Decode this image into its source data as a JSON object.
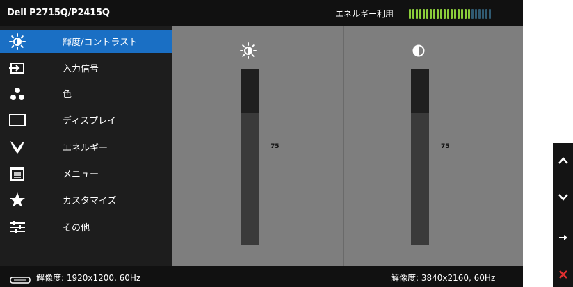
{
  "header": {
    "model": "Dell P2715Q/P2415Q",
    "energy_label": "エネルギー利用",
    "energy_level": 0.75,
    "energy_colors": {
      "on": "#8bcd3a",
      "off": "#305a72"
    }
  },
  "sidebar": {
    "items": [
      {
        "label": "輝度/コントラスト",
        "icon": "brightness-sun-icon",
        "active": true
      },
      {
        "label": "入力信号",
        "icon": "input-source-icon",
        "active": false
      },
      {
        "label": "色",
        "icon": "color-dots-icon",
        "active": false
      },
      {
        "label": "ディスプレイ",
        "icon": "display-rectangle-icon",
        "active": false
      },
      {
        "label": "エネルギー",
        "icon": "energy-leaf-icon",
        "active": false
      },
      {
        "label": "メニュー",
        "icon": "menu-list-icon",
        "active": false
      },
      {
        "label": "カスタマイズ",
        "icon": "star-icon",
        "active": false
      },
      {
        "label": "その他",
        "icon": "other-settings-icon",
        "active": false
      }
    ],
    "accent_color": "#1a6fc4"
  },
  "main": {
    "brightness": {
      "icon": "brightness-sun-icon",
      "value": "75",
      "level": 0.75
    },
    "contrast": {
      "icon": "contrast-half-circle-icon",
      "value": "75",
      "level": 0.75
    }
  },
  "status": {
    "input_icon": "cable-connector-icon",
    "current_resolution": "解像度: 1920x1200, 60Hz",
    "optimal_resolution": "解像度: 3840x2160, 60Hz"
  },
  "controls": {
    "buttons": [
      {
        "icon": "chevron-up-icon",
        "color": "#ffffff"
      },
      {
        "icon": "chevron-down-icon",
        "color": "#ffffff"
      },
      {
        "icon": "arrow-right-icon",
        "color": "#ffffff"
      },
      {
        "icon": "close-icon",
        "color": "#e03030"
      }
    ]
  }
}
